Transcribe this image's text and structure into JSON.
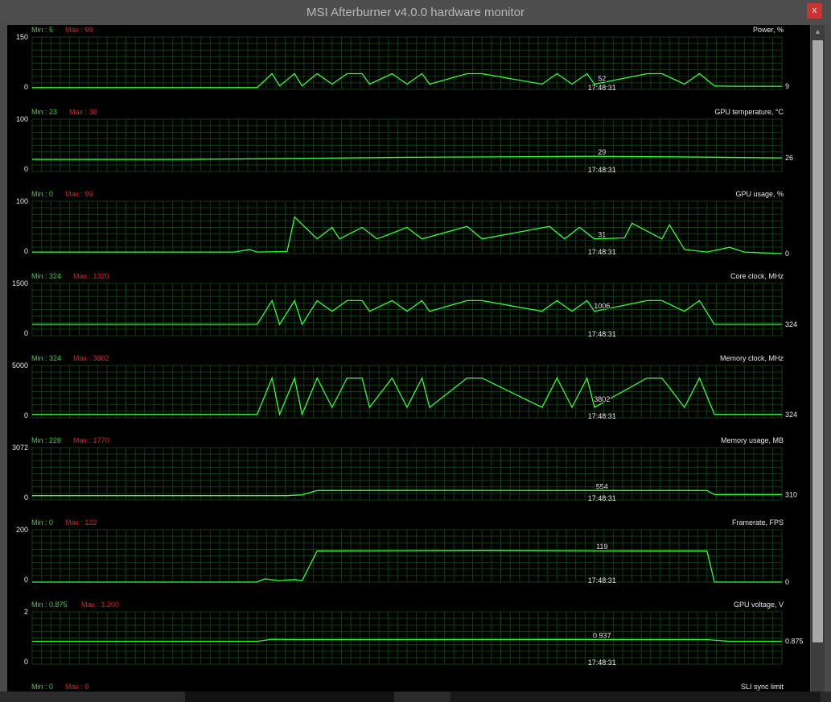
{
  "window": {
    "title": "MSI Afterburner v4.0.0 hardware monitor",
    "close_label": "x"
  },
  "colors": {
    "line": "#33ff33",
    "grid": "#123c12",
    "min_label": "#3ad23a",
    "max_label": "#e02020",
    "text": "#e8e8e8",
    "background": "#000000"
  },
  "graphs": [
    {
      "name": "Power, %",
      "min": "Min : 5",
      "max": "Max : 99",
      "ymax": "150",
      "ymin": "0",
      "current": "9",
      "cursor_value": "52",
      "time": "17:48:31",
      "y_range": [
        0,
        150
      ]
    },
    {
      "name": "GPU temperature, °C",
      "min": "Min : 23",
      "max": "Max : 38",
      "ymax": "100",
      "ymin": "0",
      "current": "26",
      "cursor_value": "29",
      "time": "17:48:31",
      "y_range": [
        0,
        100
      ]
    },
    {
      "name": "GPU usage, %",
      "min": "Min : 0",
      "max": "Max : 99",
      "ymax": "100",
      "ymin": "0",
      "current": "0",
      "cursor_value": "31",
      "time": "17:48:31",
      "y_range": [
        0,
        100
      ]
    },
    {
      "name": "Core clock, MHz",
      "min": "Min : 324",
      "max": "Max : 1320",
      "ymax": "1500",
      "ymin": "0",
      "current": "324",
      "cursor_value": "1006",
      "time": "17:48:31",
      "y_range": [
        0,
        1500
      ]
    },
    {
      "name": "Memory clock, MHz",
      "min": "Min : 324",
      "max": "Max : 3802",
      "ymax": "5000",
      "ymin": "0",
      "current": "324",
      "cursor_value": "3802",
      "time": "17:48:31",
      "y_range": [
        0,
        5000
      ]
    },
    {
      "name": "Memory usage, MB",
      "min": "Min : 226",
      "max": "Max : 1770",
      "ymax": "3072",
      "ymin": "0",
      "current": "310",
      "cursor_value": "554",
      "time": "17:48:31",
      "y_range": [
        0,
        3072
      ]
    },
    {
      "name": "Framerate, FPS",
      "min": "Min : 0",
      "max": "Max : 122",
      "ymax": "200",
      "ymin": "0",
      "current": "0",
      "cursor_value": "119",
      "time": "17:48:31",
      "y_range": [
        0,
        200
      ]
    },
    {
      "name": "GPU voltage, V",
      "min": "Min : 0.875",
      "max": "Max : 1.200",
      "ymax": "2",
      "ymin": "0",
      "current": "0.875",
      "cursor_value": "0.937",
      "time": "17:48:31",
      "y_range": [
        0,
        2
      ]
    },
    {
      "name": "SLI sync limit",
      "min": "Min : 0",
      "max": "Max : 0"
    }
  ],
  "chart_data": [
    {
      "type": "line",
      "title": "Power, %",
      "ylim": [
        0,
        150
      ],
      "x": [
        0,
        0.3,
        0.32,
        0.33,
        0.35,
        0.36,
        0.38,
        0.4,
        0.42,
        0.44,
        0.45,
        0.48,
        0.5,
        0.52,
        0.53,
        0.58,
        0.6,
        0.68,
        0.7,
        0.72,
        0.74,
        0.75,
        0.82,
        0.84,
        0.87,
        0.89,
        0.91,
        0.93,
        1.0
      ],
      "y": [
        5,
        5,
        45,
        10,
        45,
        10,
        45,
        15,
        45,
        45,
        15,
        45,
        15,
        45,
        15,
        45,
        45,
        15,
        45,
        15,
        45,
        15,
        45,
        45,
        15,
        45,
        10,
        9,
        9
      ]
    },
    {
      "type": "line",
      "title": "GPU temperature, °C",
      "ylim": [
        0,
        100
      ],
      "x": [
        0,
        0.2,
        0.35,
        0.5,
        0.75,
        0.85,
        1.0
      ],
      "y": [
        23,
        23,
        25,
        27,
        29,
        28,
        26
      ]
    },
    {
      "type": "line",
      "title": "GPU usage, %",
      "ylim": [
        0,
        100
      ],
      "x": [
        0,
        0.27,
        0.29,
        0.3,
        0.34,
        0.35,
        0.38,
        0.4,
        0.41,
        0.44,
        0.46,
        0.5,
        0.52,
        0.58,
        0.6,
        0.69,
        0.71,
        0.73,
        0.75,
        0.79,
        0.8,
        0.84,
        0.85,
        0.87,
        0.9,
        0.93,
        0.95,
        1.0
      ],
      "y": [
        3,
        3,
        8,
        3,
        4,
        70,
        28,
        50,
        28,
        50,
        28,
        50,
        28,
        52,
        28,
        52,
        28,
        50,
        28,
        30,
        58,
        28,
        55,
        8,
        3,
        12,
        3,
        0
      ]
    },
    {
      "type": "line",
      "title": "Core clock, MHz",
      "ylim": [
        0,
        1500
      ],
      "x": [
        0,
        0.3,
        0.32,
        0.33,
        0.35,
        0.36,
        0.38,
        0.4,
        0.42,
        0.44,
        0.45,
        0.48,
        0.5,
        0.52,
        0.53,
        0.58,
        0.6,
        0.68,
        0.7,
        0.72,
        0.74,
        0.75,
        0.82,
        0.84,
        0.87,
        0.89,
        0.91,
        0.93,
        1.0
      ],
      "y": [
        324,
        324,
        1006,
        324,
        1006,
        324,
        1006,
        700,
        1006,
        1006,
        700,
        1006,
        700,
        1006,
        700,
        1006,
        1006,
        700,
        1006,
        700,
        1006,
        700,
        1006,
        1006,
        700,
        1006,
        324,
        324,
        324
      ]
    },
    {
      "type": "line",
      "title": "Memory clock, MHz",
      "ylim": [
        0,
        5000
      ],
      "x": [
        0,
        0.3,
        0.32,
        0.33,
        0.35,
        0.36,
        0.38,
        0.4,
        0.42,
        0.44,
        0.45,
        0.48,
        0.5,
        0.52,
        0.53,
        0.58,
        0.6,
        0.68,
        0.7,
        0.72,
        0.74,
        0.75,
        0.82,
        0.84,
        0.87,
        0.89,
        0.91,
        0.93,
        1.0
      ],
      "y": [
        324,
        324,
        3802,
        324,
        3802,
        324,
        3802,
        1000,
        3802,
        3802,
        1000,
        3802,
        1000,
        3802,
        1000,
        3802,
        3802,
        1000,
        3802,
        1000,
        3802,
        1000,
        3802,
        3802,
        1000,
        3802,
        324,
        324,
        324
      ]
    },
    {
      "type": "line",
      "title": "Memory usage, MB",
      "ylim": [
        0,
        3072
      ],
      "x": [
        0,
        0.34,
        0.36,
        0.38,
        0.5,
        0.7,
        0.85,
        0.9,
        0.91,
        1.0
      ],
      "y": [
        250,
        250,
        300,
        554,
        560,
        554,
        554,
        554,
        310,
        310
      ]
    },
    {
      "type": "line",
      "title": "Framerate, FPS",
      "ylim": [
        0,
        200
      ],
      "x": [
        0,
        0.3,
        0.31,
        0.33,
        0.35,
        0.36,
        0.38,
        0.6,
        0.8,
        0.9,
        0.91,
        1.0
      ],
      "y": [
        0,
        0,
        12,
        5,
        10,
        5,
        119,
        121,
        119,
        119,
        0,
        0
      ]
    },
    {
      "type": "line",
      "title": "GPU voltage, V",
      "ylim": [
        0,
        2
      ],
      "x": [
        0,
        0.3,
        0.32,
        0.35,
        0.4,
        0.5,
        0.7,
        0.8,
        0.9,
        0.93,
        1.0
      ],
      "y": [
        0.875,
        0.875,
        0.95,
        0.937,
        0.937,
        0.937,
        0.945,
        0.937,
        0.937,
        0.875,
        0.875
      ]
    }
  ]
}
